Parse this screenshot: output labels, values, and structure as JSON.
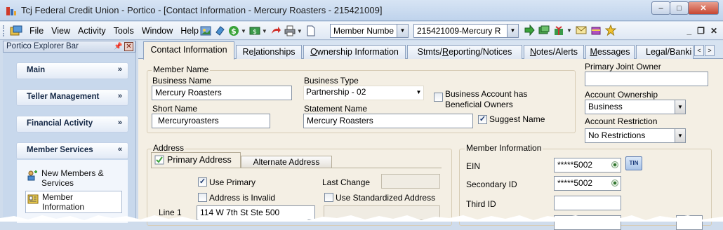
{
  "window": {
    "title": "Tcj Federal Credit Union - Portico - [Contact Information - Mercury Roasters - 215421009]",
    "buttons": {
      "minimize": "–",
      "maximize": "□",
      "close": "✕"
    }
  },
  "menubar": {
    "items": [
      "File",
      "View",
      "Activity",
      "Tools",
      "Window",
      "Help"
    ],
    "search_type": "Member Numbe",
    "member_selector": "215421009-Mercury R",
    "mdi_controls": {
      "minimize": "_",
      "restore": "❐",
      "close": "✕"
    },
    "toolbar_icons": [
      "photo-icon",
      "coin-icon",
      "dollar-icon",
      "cash-icon",
      "arrow-icon",
      "printer-icon",
      "document-icon",
      "go-icon",
      "cash-stack-icon",
      "gift-icon",
      "mail-icon",
      "package-icon",
      "star-icon"
    ]
  },
  "explorer": {
    "title": "Portico Explorer Bar",
    "sections": [
      {
        "label": "Main",
        "chevron": "»"
      },
      {
        "label": "Teller Management",
        "chevron": "»"
      },
      {
        "label": "Financial Activity",
        "chevron": "»"
      },
      {
        "label": "Member Services",
        "chevron": "«"
      }
    ],
    "links": [
      {
        "label_line1": "New Members &",
        "label_line2": "Services"
      },
      {
        "label_line1": "Member",
        "label_line2": "Information"
      }
    ]
  },
  "tabs": [
    {
      "label": "Contact Information",
      "active": true
    },
    {
      "label_pre": "Re",
      "label_u": "l",
      "label_post": "ationships"
    },
    {
      "label_pre": "",
      "label_u": "O",
      "label_post": "wnership Information"
    },
    {
      "label_pre": "Stmts/",
      "label_u": "R",
      "label_post": "eporting/Notices"
    },
    {
      "label_pre": "",
      "label_u": "N",
      "label_post": "otes/Alerts"
    },
    {
      "label_pre": "",
      "label_u": "M",
      "label_post": "essages"
    },
    {
      "label_pre": "Legal/Banki",
      "label_u": "",
      "label_post": ""
    }
  ],
  "member_name": {
    "legend": "Member Name",
    "business_name_label": "Business Name",
    "business_name": "Mercury Roasters",
    "business_type_label": "Business Type",
    "business_type": "Partnership - 02",
    "beneficial_label_1": "Business Account has",
    "beneficial_label_2": "Beneficial Owners",
    "short_name_label": "Short Name",
    "short_name": "Mercuryroasters",
    "statement_name_label": "Statement Name",
    "statement_name": "Mercury Roasters",
    "suggest_name_label": "Suggest Name"
  },
  "right_panel": {
    "primary_joint_owner_label": "Primary Joint Owner",
    "primary_joint_owner": "",
    "account_ownership_label": "Account Ownership",
    "account_ownership": "Business",
    "account_restriction_label": "Account Restriction",
    "account_restriction": "No Restrictions"
  },
  "address": {
    "legend": "Address",
    "tab_primary": "Primary Address",
    "tab_alternate": "Alternate Address",
    "use_primary_label": "Use Primary",
    "address_invalid_label": "Address is Invalid",
    "last_change_label": "Last Change",
    "last_change": "",
    "use_standardized_label": "Use Standardized Address",
    "line1_label": "Line 1",
    "line1": "114 W 7th St Ste 500"
  },
  "member_info": {
    "legend": "Member Information",
    "ein_label": "EIN",
    "ein": "*****5002",
    "tin_badge": "TIN",
    "secondary_id_label": "Secondary ID",
    "secondary_id": "*****5002",
    "third_id_label": "Third ID",
    "third_id": ""
  },
  "colors": {
    "panel_bg": "#f4efe4",
    "chrome": "#cfdcec"
  }
}
